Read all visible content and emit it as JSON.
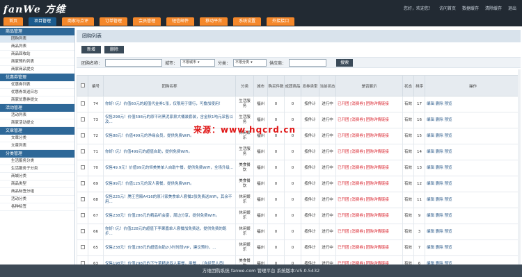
{
  "app": {
    "logo": "fanWe 方维"
  },
  "toplinks": [
    "您好，欢迎您！",
    "访问首页",
    "数据缓存",
    "清除缓存",
    "退出"
  ],
  "nav": [
    "首页",
    "项目管理",
    "商家与点评",
    "订单管理",
    "会员管理",
    "短信邮件",
    "移动平台",
    "系统设置",
    "外接接口"
  ],
  "nav_active": 1,
  "sidebar": [
    {
      "group": "商品管理",
      "items": [
        "团购列表",
        "商品列表",
        "商品回收站",
        "商家预约列表",
        "商家商品提交"
      ]
    },
    {
      "group": "优惠券管理",
      "items": [
        "优惠券列表",
        "优惠券发送日志",
        "商家优惠券提交"
      ]
    },
    {
      "group": "活动管理",
      "items": [
        "活动列表",
        "商家活动提交"
      ]
    },
    {
      "group": "文章管理",
      "items": [
        "文章分类",
        "文章列表"
      ]
    },
    {
      "group": "分类管理",
      "items": [
        "生活服务分类",
        "生活服务子分类",
        "商城分类",
        "商品类型",
        "商品标签分组",
        "活动分类",
        "各种标签"
      ]
    }
  ],
  "sidebar_active": "团购列表",
  "main": {
    "title": "团购列表",
    "buttons": [
      "新增",
      "删除"
    ],
    "filter": {
      "name_label": "团购名称：",
      "city_label": "城市：",
      "city_value": "不限城市",
      "cate_label": "分类：",
      "cate_value": "不限分类",
      "supplier_label": "供应商：",
      "search_label": "搜索"
    }
  },
  "table": {
    "headers": [
      "",
      "编号",
      "团购名称",
      "分类",
      "城市",
      "购买件数",
      "成团商品",
      "发券类型",
      "当前状态",
      "是否展示",
      "状态",
      "排序",
      "操作"
    ],
    "rows": [
      {
        "id": "74",
        "name": "你好!!元！价值60元的超值代金券1张，仅限用于银行，可叠加使用！",
        "cate": "生活服务",
        "city": "福州",
        "buy": "0",
        "ok": "0",
        "type": "按件计",
        "status": "进行中",
        "show": "已开团 [消费券] 团购详情链接",
        "state": "有效",
        "sort": "17",
        "ops": "编辑 删除 预览"
      },
      {
        "id": "73",
        "name": "仅售298元！价值598元的原平利黑泥家泉大桶装套装，含金秋1吨元采售以及...",
        "cate": "生活服务",
        "city": "福州",
        "buy": "0",
        "ok": "0",
        "type": "按件计",
        "status": "进行中",
        "show": "已开团 [消费券] 团购详情链接",
        "state": "有效",
        "sort": "16",
        "ops": "编辑 删除 预览"
      },
      {
        "id": "72",
        "name": "仅售88元！价值499元的净缘会员，提供免费WiFi。",
        "cate": "休闲娱乐",
        "city": "福州",
        "buy": "0",
        "ok": "0",
        "type": "按件计",
        "status": "进行中",
        "show": "已开团 [消费券] 团购详情链接",
        "state": "有效",
        "sort": "15",
        "ops": "编辑 删除 预览"
      },
      {
        "id": "71",
        "name": "你好!!元！价值499元的超值自助，提供免费WiFi。",
        "cate": "生活服务",
        "city": "福州",
        "buy": "0",
        "ok": "0",
        "type": "按件计",
        "status": "进行中",
        "show": "已开团 [消费券] 团购详情链接",
        "state": "有效",
        "sort": "14",
        "ops": "编辑 删除 预览"
      },
      {
        "id": "70",
        "name": "仅售49.9元！价值99元的恒美美单人自助午餐，提供免费WiFi，全场升级...",
        "cate": "美食餐饮",
        "city": "福州",
        "buy": "0",
        "ok": "0",
        "type": "按件计",
        "status": "进行中",
        "show": "已开团 [消费券] 团购详情链接",
        "state": "有效",
        "sort": "13",
        "ops": "编辑 删除 预览"
      },
      {
        "id": "69",
        "name": "仅售99元！价值125元的双人套餐，提供免费WiFi。",
        "cate": "美食餐饮",
        "city": "福州",
        "buy": "0",
        "ok": "0",
        "type": "按件计",
        "status": "进行中",
        "show": "已开团 [消费券] 团购详情链接",
        "state": "有效",
        "sort": "12",
        "ops": "编辑 删除 预览"
      },
      {
        "id": "68",
        "name": "仅售225元！腾王宫殿A416的原汁家美食单人套餐2张免费送WiFi，其余不用...",
        "cate": "休闲娱乐",
        "city": "福州",
        "buy": "0",
        "ok": "0",
        "type": "按件计",
        "status": "进行中",
        "show": "已开团 [消费券] 团购详情链接",
        "state": "有效",
        "sort": "11",
        "ops": "编辑 删除 预览"
      },
      {
        "id": "67",
        "name": "仅售238元！价值286元的精品听会宴，周边分享，提供免费WiFi。",
        "cate": "休闲娱乐",
        "city": "福州",
        "buy": "0",
        "ok": "0",
        "type": "按件计",
        "status": "进行中",
        "show": "已开团 [消费券] 团购详情链接",
        "state": "有效",
        "sort": "9",
        "ops": "编辑 删除 预览"
      },
      {
        "id": "66",
        "name": "你好!!元！价值228元的超值下李果嘉单人套餐加免费送，提供免费的跑步...",
        "cate": "休闲娱乐",
        "city": "福州",
        "buy": "0",
        "ok": "0",
        "type": "按件计",
        "status": "进行中",
        "show": "已开团 [消费券] 团购详情链接",
        "state": "有效",
        "sort": "3",
        "ops": "编辑 删除 预览"
      },
      {
        "id": "65",
        "name": "仅售238元！价值288元的超值自助2小时时段VIP，建议预约，...",
        "cate": "休闲娱乐",
        "city": "福州",
        "buy": "0",
        "ok": "0",
        "type": "按件计",
        "status": "进行中",
        "show": "已开团 [消费券] 团购详情链接",
        "state": "有效",
        "sort": "7",
        "ops": "编辑 删除 预览"
      },
      {
        "id": "63",
        "name": "仅售198元！价值298元的下午茶精选双人套餐，用餐...（含经营人员）",
        "cate": "美食餐饮",
        "city": "福州",
        "buy": "0",
        "ok": "0",
        "type": "按件计",
        "status": "进行中",
        "show": "已开团 [消费券] 团购详情链接",
        "state": "有效",
        "sort": "6",
        "ops": "编辑 删除 预览"
      }
    ]
  },
  "footer": "方维团购系统 fanwe.com 管理平台 系统版本:V5.0.5432",
  "watermark": "来源：www.hqcrd.cn"
}
